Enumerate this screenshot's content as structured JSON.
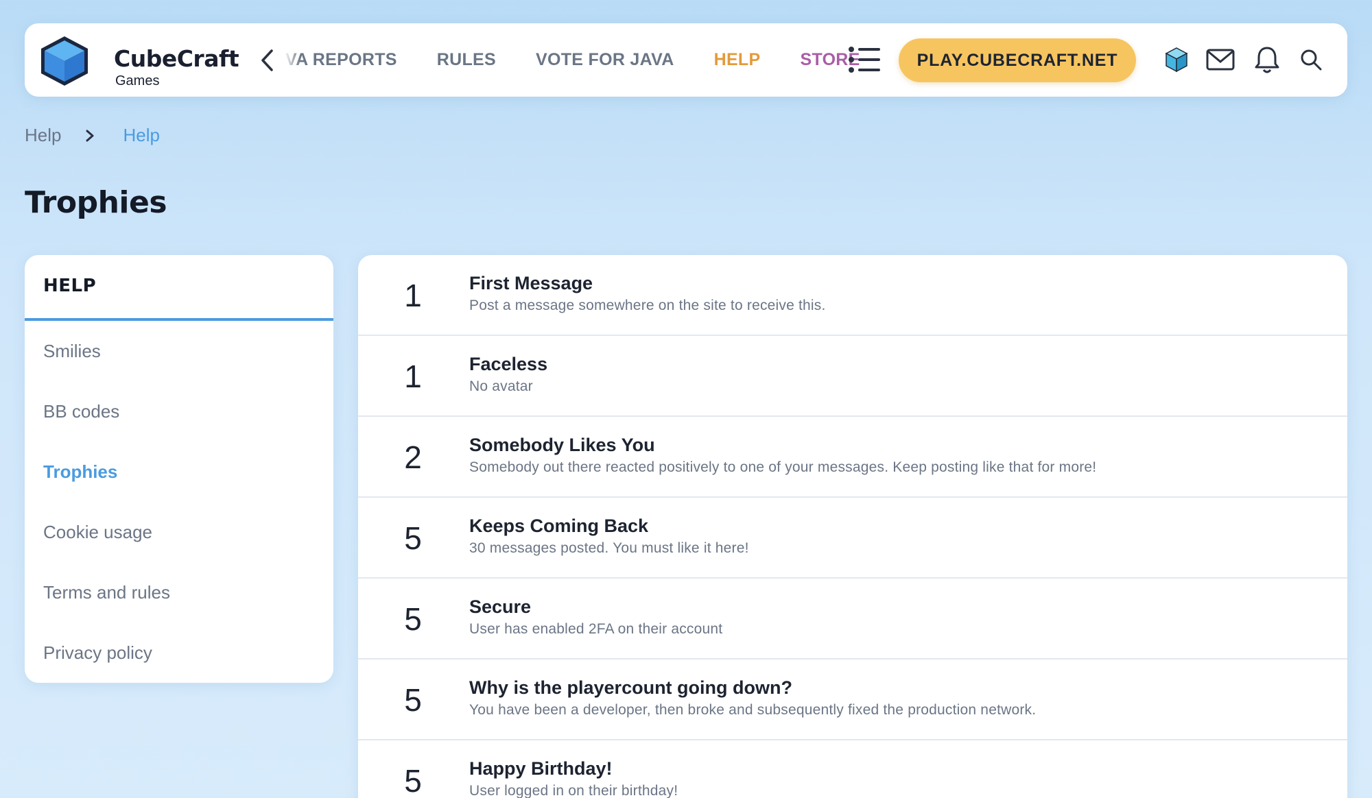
{
  "header": {
    "logo_title": "CubeCraft",
    "logo_subtitle": "Games",
    "nav": [
      "VA REPORTS",
      "RULES",
      "VOTE FOR JAVA",
      "HELP",
      "STORE"
    ],
    "play_button": "PLAY.CUBECRAFT.NET",
    "icons": [
      "chevron-left-icon",
      "menu-list-icon",
      "cube-icon",
      "mail-icon",
      "bell-icon",
      "search-icon"
    ],
    "colors": {
      "help": "#e39a3b",
      "store": "#a95ea6",
      "play": "#f7c560",
      "accent": "#4a9be0"
    }
  },
  "breadcrumb": [
    "Help",
    "Help"
  ],
  "page_title": "Trophies",
  "sidebar": {
    "heading": "HELP",
    "items": [
      "Smilies",
      "BB codes",
      "Trophies",
      "Cookie usage",
      "Terms and rules",
      "Privacy policy"
    ],
    "active": "Trophies"
  },
  "trophies": [
    {
      "points": "1",
      "title": "First Message",
      "desc": "Post a message somewhere on the site to receive this."
    },
    {
      "points": "1",
      "title": "Faceless",
      "desc": "No avatar"
    },
    {
      "points": "2",
      "title": "Somebody Likes You",
      "desc": "Somebody out there reacted positively to one of your messages. Keep posting like that for more!"
    },
    {
      "points": "5",
      "title": "Keeps Coming Back",
      "desc": "30 messages posted. You must like it here!"
    },
    {
      "points": "5",
      "title": "Secure",
      "desc": "User has enabled 2FA on their account"
    },
    {
      "points": "5",
      "title": "Why is the playercount going down?",
      "desc": "You have been a developer, then broke and subsequently fixed the production network."
    },
    {
      "points": "5",
      "title": "Happy Birthday!",
      "desc": "User logged in on their birthday!"
    }
  ]
}
